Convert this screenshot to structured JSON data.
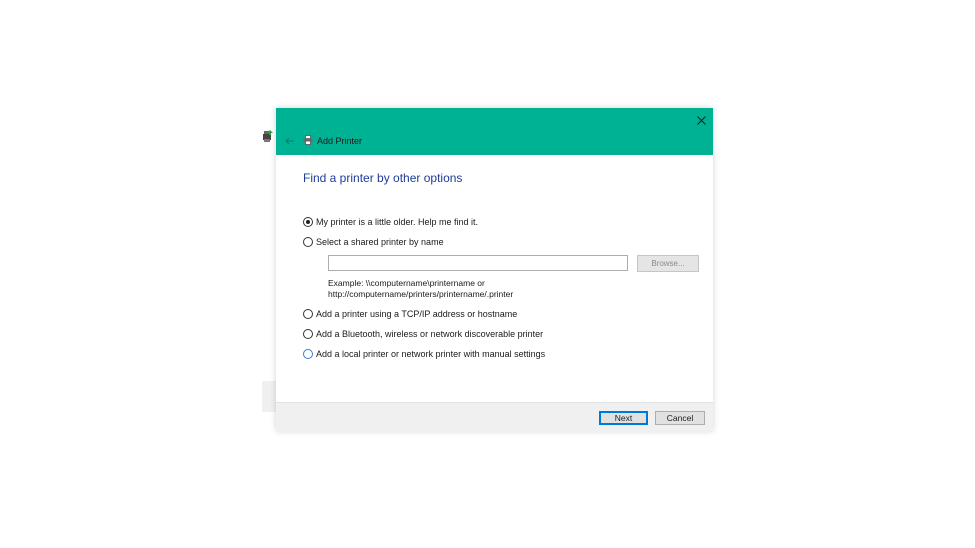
{
  "window": {
    "title": "Add Printer",
    "close_icon": "close-icon",
    "accent_color": "#00b294"
  },
  "page": {
    "heading": "Find a printer by other options"
  },
  "options": [
    {
      "label": "My printer is a little older. Help me find it.",
      "selected": true
    },
    {
      "label": "Select a shared printer by name",
      "selected": false
    },
    {
      "label": "Add a printer using a TCP/IP address or hostname",
      "selected": false
    },
    {
      "label": "Add a Bluetooth, wireless or network discoverable printer",
      "selected": false
    },
    {
      "label": "Add a local printer or network printer with manual settings",
      "selected": false
    }
  ],
  "shared_printer": {
    "value": "",
    "browse_label": "Browse...",
    "example_line1": "Example: \\\\computername\\printername or",
    "example_line2": "http://computername/printers/printername/.printer"
  },
  "footer": {
    "next_label": "Next",
    "cancel_label": "Cancel"
  }
}
